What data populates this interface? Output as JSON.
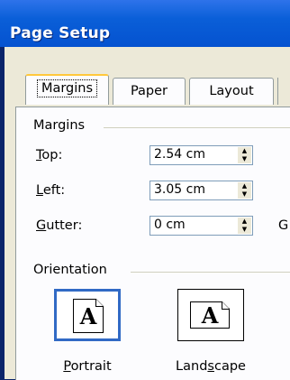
{
  "window": {
    "title": "Page Setup"
  },
  "tabs": [
    {
      "label": "Margins",
      "active": true
    },
    {
      "label": "Paper",
      "active": false
    },
    {
      "label": "Layout",
      "active": false
    }
  ],
  "margins": {
    "group_label": "Margins",
    "top": {
      "label_mnemonic": "T",
      "label_rest": "op:",
      "value": "2.54 cm"
    },
    "left": {
      "label_mnemonic": "L",
      "label_rest": "eft:",
      "value": "3.05 cm"
    },
    "gutter": {
      "label_mnemonic": "G",
      "label_rest": "utter:",
      "value": "0 cm"
    },
    "gutter_position_label_cut": "G"
  },
  "orientation": {
    "group_label": "Orientation",
    "portrait": {
      "label_mnemonic": "P",
      "label_rest": "ortrait",
      "selected": true
    },
    "landscape": {
      "label_pre": "Land",
      "label_mnemonic": "s",
      "label_rest": "cape",
      "selected": false
    },
    "icon_glyph": "A"
  },
  "colors": {
    "title_bar": "#0a5fd8",
    "selection_border": "#316ac5",
    "tab_highlight": "#ffc83c"
  }
}
